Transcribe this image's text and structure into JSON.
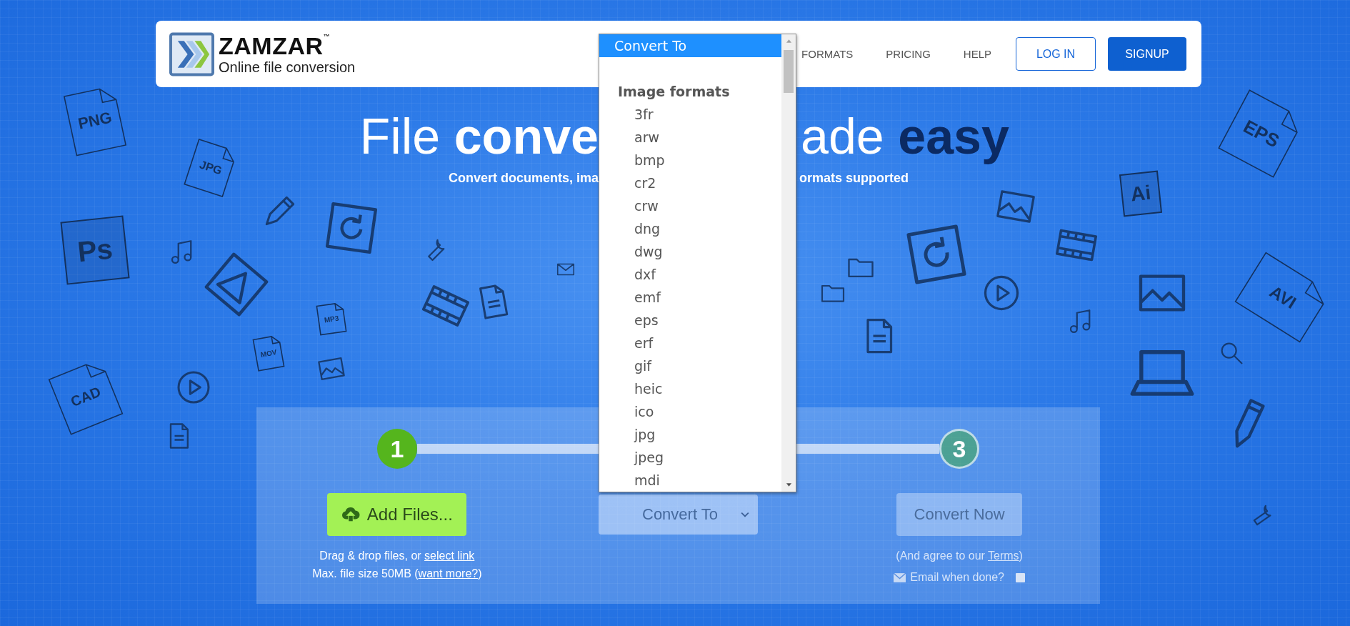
{
  "header": {
    "logo": {
      "name": "ZAMZAR$^{™}$",
      "tagline": "Online file conversion"
    },
    "nav": [
      "FORMATS",
      "PRICING",
      "HELP"
    ],
    "login": "LOG IN",
    "signup": "SIGNUP"
  },
  "hero": {
    "title_left": {
      "plain": "File",
      "bold": "conve"
    },
    "title_right": {
      "plain": "ade",
      "emphasis": "easy"
    },
    "subtitle_left": "Convert documents, ima",
    "subtitle_right": "ormats supported"
  },
  "doodles": [
    {
      "kind": "file",
      "label": "PNG"
    },
    {
      "kind": "file",
      "label": "JPG"
    },
    {
      "kind": "tile",
      "label": "Ps"
    },
    {
      "kind": "file",
      "label": "CAD"
    },
    {
      "kind": "file",
      "label": "EPS"
    },
    {
      "kind": "tile",
      "label": "Ai"
    },
    {
      "kind": "file",
      "label": "AVI"
    },
    {
      "kind": "file",
      "label": "MP3"
    },
    {
      "kind": "file",
      "label": "MOV"
    }
  ],
  "converter": {
    "steps": [
      {
        "number": "1",
        "active": true
      },
      {
        "number": "3",
        "active": false
      }
    ],
    "add_files": "Add Files...",
    "drag_hint": {
      "text": "Drag & drop files, or ",
      "link": "select link"
    },
    "size_hint": {
      "text": "Max. file size 50MB (",
      "link": "want more?",
      "after": ")"
    },
    "format_select": {
      "value": "Convert To"
    },
    "convert_now": {
      "label": "Convert Now",
      "disabled": true
    },
    "terms": {
      "text": "(And agree to our ",
      "link": "Terms",
      "after": ")"
    },
    "email": {
      "label": "Email when done?",
      "checked": false
    }
  },
  "dropdown": {
    "options": [
      {
        "label": "Convert To",
        "selected": true
      }
    ],
    "groups": [
      {
        "label": "Image formats",
        "options": [
          {
            "label": "3fr",
            "selected": false
          },
          {
            "label": "arw",
            "selected": false
          },
          {
            "label": "bmp",
            "selected": false
          },
          {
            "label": "cr2",
            "selected": false
          },
          {
            "label": "crw",
            "selected": false
          },
          {
            "label": "dng",
            "selected": false
          },
          {
            "label": "dwg",
            "selected": false
          },
          {
            "label": "dxf",
            "selected": false
          },
          {
            "label": "emf",
            "selected": false
          },
          {
            "label": "eps",
            "selected": false
          },
          {
            "label": "erf",
            "selected": false
          },
          {
            "label": "gif",
            "selected": false
          },
          {
            "label": "heic",
            "selected": false
          },
          {
            "label": "ico",
            "selected": false
          },
          {
            "label": "jpg",
            "selected": false
          },
          {
            "label": "jpeg",
            "selected": false
          },
          {
            "label": "mdi",
            "selected": false
          }
        ]
      }
    ]
  }
}
